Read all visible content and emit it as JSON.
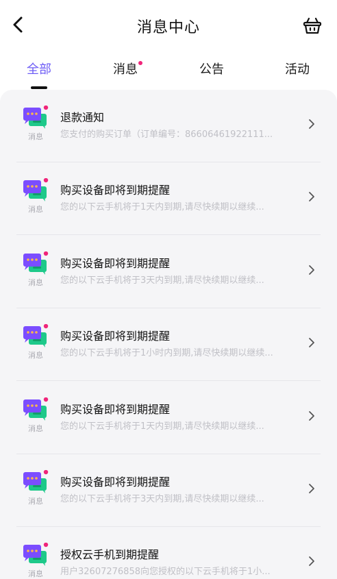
{
  "header": {
    "title": "消息中心",
    "back_icon": "chevron-left-icon",
    "basket_icon": "basket-icon"
  },
  "tabs": [
    {
      "label": "全部",
      "active": true,
      "has_dot": false
    },
    {
      "label": "消息",
      "active": false,
      "has_dot": true
    },
    {
      "label": "公告",
      "active": false,
      "has_dot": false
    },
    {
      "label": "活动",
      "active": false,
      "has_dot": false
    }
  ],
  "colors": {
    "accent": "#6d5cf6",
    "dot": "#f0257a",
    "icon_purple": "#7b4dff",
    "icon_green": "#1ec98a"
  },
  "messages": [
    {
      "category": "消息",
      "title": "退款通知",
      "desc": "您支付的购买订单（订单编号：86606461922111..."
    },
    {
      "category": "消息",
      "title": "购买设备即将到期提醒",
      "desc": "您的以下云手机将于1天内到期,请尽快续期以继续..."
    },
    {
      "category": "消息",
      "title": "购买设备即将到期提醒",
      "desc": "您的以下云手机将于3天内到期,请尽快续期以继续..."
    },
    {
      "category": "消息",
      "title": "购买设备即将到期提醒",
      "desc": "您的以下云手机将于1小时内到期,请尽快续期以继续..."
    },
    {
      "category": "消息",
      "title": "购买设备即将到期提醒",
      "desc": "您的以下云手机将于1天内到期,请尽快续期以继续..."
    },
    {
      "category": "消息",
      "title": "购买设备即将到期提醒",
      "desc": "您的以下云手机将于3天内到期,请尽快续期以继续..."
    },
    {
      "category": "消息",
      "title": "授权云手机到期提醒",
      "desc": "用户32607276858向您授权的以下云手机将于1小..."
    }
  ]
}
